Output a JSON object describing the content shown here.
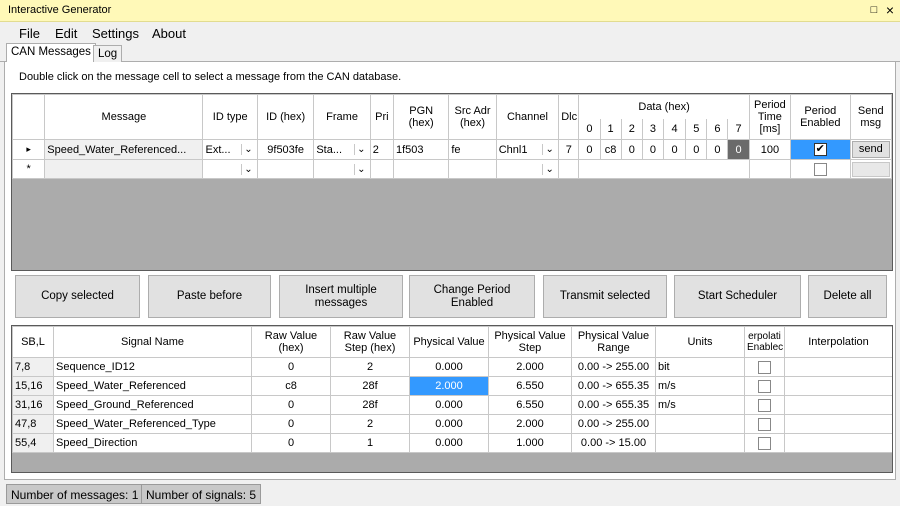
{
  "window": {
    "title": "Interactive Generator",
    "restore_glyph": "□",
    "close_glyph": "×"
  },
  "menu": {
    "file": "File",
    "edit": "Edit",
    "settings": "Settings",
    "about": "About"
  },
  "tabs": {
    "can_messages": "CAN Messages",
    "log": "Log"
  },
  "hint": "Double click on the message cell to select a message from the CAN database.",
  "messages": {
    "headers": {
      "message": "Message",
      "id_type": "ID type",
      "id_hex": "ID (hex)",
      "frame": "Frame",
      "pri": "Pri",
      "pgn": "PGN (hex)",
      "src": "Src Adr (hex)",
      "channel": "Channel",
      "dlc": "Dlc",
      "data": "Data (hex)",
      "period_time": "Period Time [ms]",
      "period_enabled": "Period Enabled",
      "send_msg": "Send msg",
      "data_idx": [
        "0",
        "1",
        "2",
        "3",
        "4",
        "5",
        "6",
        "7"
      ]
    },
    "row": {
      "message": "Speed_Water_Referenced...",
      "id_type": "Ext...",
      "id_hex": "9f503fe",
      "frame": "Sta...",
      "pri": "2",
      "pgn": "1f503",
      "src": "fe",
      "channel": "Chnl1",
      "dlc": "7",
      "data": [
        "0",
        "c8",
        "0",
        "0",
        "0",
        "0",
        "0",
        "0"
      ],
      "period_time": "100",
      "period_enabled": "✔",
      "send": "send"
    },
    "new_row_marker": "*",
    "current_row_marker": "▸"
  },
  "buttons": {
    "copy": "Copy selected",
    "paste": "Paste before",
    "insert": "Insert multiple messages",
    "change_period": "Change Period Enabled",
    "transmit": "Transmit selected",
    "scheduler": "Start Scheduler",
    "delete_all": "Delete all"
  },
  "signals": {
    "headers": {
      "sbl": "SB,L",
      "name": "Signal Name",
      "raw_value": "Raw Value (hex)",
      "raw_step": "Raw Value Step (hex)",
      "phys_value": "Physical Value",
      "phys_step": "Physical Value Step",
      "phys_range": "Physical Value Range",
      "units": "Units",
      "interp_enabled": "erpolati Enablec",
      "interpolation": "Interpolation"
    },
    "rows": [
      {
        "sbl": "7,8",
        "name": "Sequence_ID12",
        "raw": "0",
        "raw_step": "2",
        "phys": "0.000",
        "phys_step": "2.000",
        "range": "0.00 -> 255.00",
        "units": "bit"
      },
      {
        "sbl": "15,16",
        "name": "Speed_Water_Referenced",
        "raw": "c8",
        "raw_step": "28f",
        "phys": "2.000",
        "phys_step": "6.550",
        "range": "0.00 -> 655.35",
        "units": "m/s"
      },
      {
        "sbl": "31,16",
        "name": "Speed_Ground_Referenced",
        "raw": "0",
        "raw_step": "28f",
        "phys": "0.000",
        "phys_step": "6.550",
        "range": "0.00 -> 655.35",
        "units": "m/s"
      },
      {
        "sbl": "47,8",
        "name": "Speed_Water_Referenced_Type",
        "raw": "0",
        "raw_step": "2",
        "phys": "0.000",
        "phys_step": "2.000",
        "range": "0.00 -> 255.00",
        "units": ""
      },
      {
        "sbl": "55,4",
        "name": "Speed_Direction",
        "raw": "0",
        "raw_step": "1",
        "phys": "0.000",
        "phys_step": "1.000",
        "range": "0.00 -> 15.00",
        "units": ""
      }
    ]
  },
  "status": {
    "messages": "Number of messages: 1",
    "signals": "Number of signals: 5"
  },
  "dropdown_glyph": "⌄"
}
